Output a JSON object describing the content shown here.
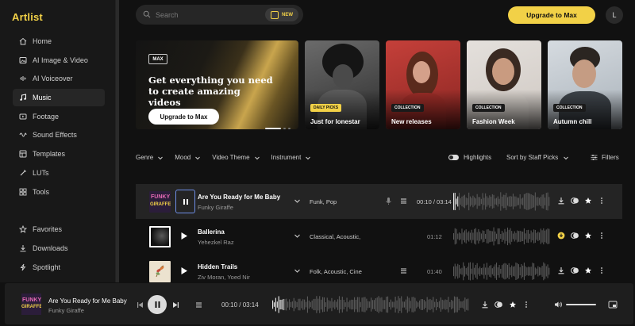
{
  "app": {
    "logo": "Artlist"
  },
  "sidebar": {
    "items": [
      {
        "label": "Home",
        "icon": "home-icon"
      },
      {
        "label": "AI Image & Video",
        "icon": "ai-image-icon"
      },
      {
        "label": "AI Voiceover",
        "icon": "voiceover-icon"
      },
      {
        "label": "Music",
        "icon": "music-icon",
        "active": true
      },
      {
        "label": "Footage",
        "icon": "footage-icon"
      },
      {
        "label": "Sound Effects",
        "icon": "sound-effects-icon"
      },
      {
        "label": "Templates",
        "icon": "templates-icon"
      },
      {
        "label": "LUTs",
        "icon": "luts-icon"
      },
      {
        "label": "Tools",
        "icon": "tools-icon"
      }
    ],
    "secondary": [
      {
        "label": "Favorites",
        "icon": "star-icon"
      },
      {
        "label": "Downloads",
        "icon": "download-icon"
      },
      {
        "label": "Spotlight",
        "icon": "spotlight-icon"
      }
    ]
  },
  "topbar": {
    "search_placeholder": "Search",
    "new_label": "NEW",
    "upgrade_label": "Upgrade to Max",
    "avatar_initial": "L"
  },
  "hero": {
    "badge": "MAX",
    "title": "Get everything you need to create amazing videos",
    "button": "Upgrade to Max"
  },
  "cards": [
    {
      "tag": "DAILY PICKS",
      "label": "Just for lonestar"
    },
    {
      "tag": "COLLECTION",
      "label": "New releases"
    },
    {
      "tag": "COLLECTION",
      "label": "Fashion Week"
    },
    {
      "tag": "COLLECTION",
      "label": "Autumn chill"
    }
  ],
  "filters": {
    "genre": "Genre",
    "mood": "Mood",
    "video_theme": "Video Theme",
    "instrument": "Instrument",
    "highlights": "Highlights",
    "sort": "Sort by Staff Picks",
    "filters": "Filters"
  },
  "tracks": [
    {
      "title": "Are You Ready for Me Baby",
      "artist": "Funky Giraffe",
      "genre": "Funk, Pop",
      "time": "00:10 / 03:14",
      "playing": true
    },
    {
      "title": "Ballerina",
      "artist": "Yehezkel Raz",
      "genre": "Classical, Acoustic,",
      "duration": "01:12",
      "downloaded": true
    },
    {
      "title": "Hidden Trails",
      "artist": "Ziv Moran, Yoed Nir",
      "genre": "Folk, Acoustic, Cine",
      "duration": "01:40"
    }
  ],
  "player": {
    "title": "Are You Ready for Me Baby",
    "artist": "Funky Giraffe",
    "time": "00:10 / 03:14",
    "thumb_text": "FUNKY GIRAFFE"
  },
  "colors": {
    "accent": "#f2d147",
    "background": "#111111",
    "active_row": "#242424"
  }
}
